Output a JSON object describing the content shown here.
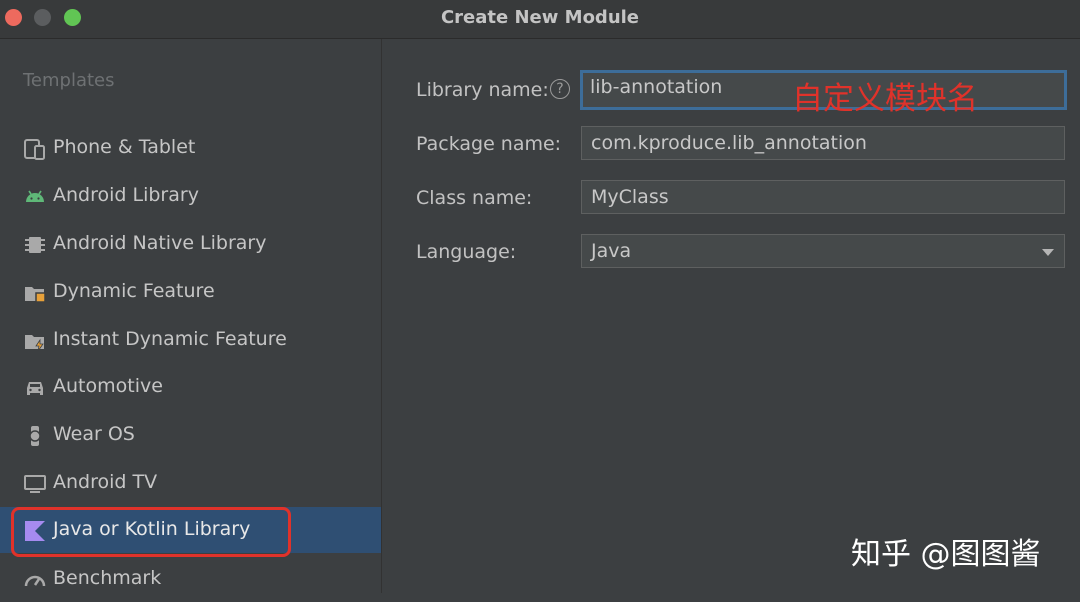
{
  "window": {
    "title": "Create New Module"
  },
  "sidebar": {
    "heading": "Templates",
    "items": [
      {
        "label": "Phone & Tablet",
        "icon": "phone-tablet-icon"
      },
      {
        "label": "Android Library",
        "icon": "android-icon"
      },
      {
        "label": "Android Native Library",
        "icon": "chip-icon"
      },
      {
        "label": "Dynamic Feature",
        "icon": "folder-feature-icon"
      },
      {
        "label": "Instant Dynamic Feature",
        "icon": "folder-instant-icon"
      },
      {
        "label": "Automotive",
        "icon": "car-icon"
      },
      {
        "label": "Wear OS",
        "icon": "watch-icon"
      },
      {
        "label": "Android TV",
        "icon": "tv-icon"
      },
      {
        "label": "Java or Kotlin Library",
        "icon": "kotlin-icon",
        "selected": true
      },
      {
        "label": "Benchmark",
        "icon": "gauge-icon"
      }
    ]
  },
  "form": {
    "library_name_label": "Library name:",
    "library_name_value": "lib-annotation",
    "package_name_label": "Package name:",
    "package_name_value": "com.kproduce.lib_annotation",
    "class_name_label": "Class name:",
    "class_name_value": "MyClass",
    "language_label": "Language:",
    "language_value": "Java",
    "help_glyph": "?"
  },
  "annotation_text": "自定义模块名",
  "watermark_text": "知乎 @图图酱",
  "colors": {
    "accent_selected": "#2f4f73",
    "annotation_red": "#e0322a",
    "focus_border": "#3d6d99"
  }
}
